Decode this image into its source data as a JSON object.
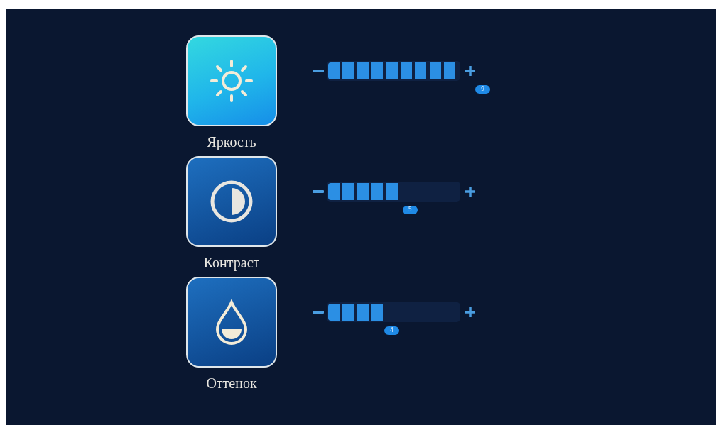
{
  "settings": [
    {
      "kind": "brightness",
      "label": "Яркость",
      "selected": true,
      "level": 1,
      "value": "9"
    },
    {
      "kind": "contrast",
      "label": "Контраст",
      "selected": false,
      "level": 0.556,
      "value": "5"
    },
    {
      "kind": "hue",
      "label": "Оттенок",
      "selected": false,
      "level": 0.444,
      "value": "4"
    }
  ]
}
